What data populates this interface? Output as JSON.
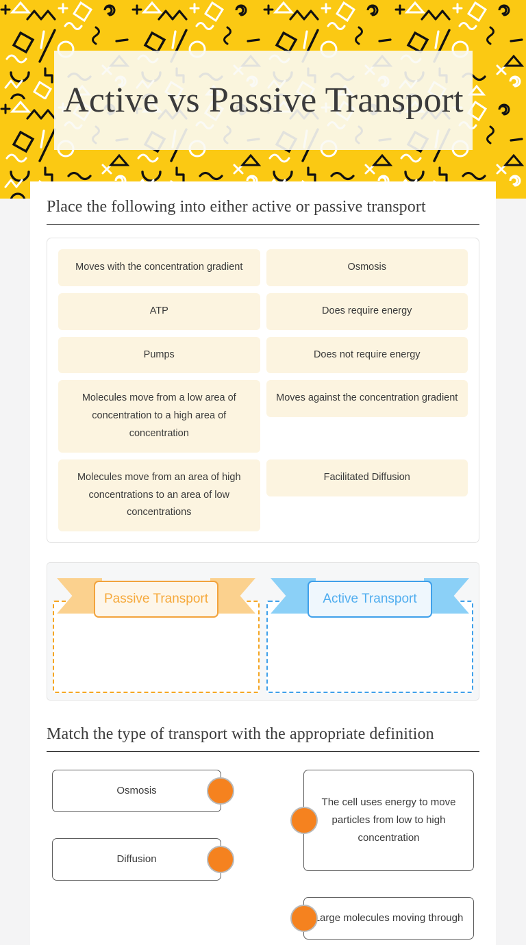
{
  "header": {
    "title": "Active vs Passive Transport",
    "background_color": "#FBC913",
    "title_box_color": "#FAF9F4"
  },
  "sections": {
    "sort": {
      "heading": "Place the following into either active or passive transport",
      "items_left": [
        "Moves with the concentration gradient",
        "ATP",
        "Pumps",
        "Molecules move from a low area of concentration to a high area of concentration",
        "Molecules move from an area of high concentrations to an area of low concentrations"
      ],
      "items_right": [
        "Osmosis",
        "Does require energy",
        "Does not require energy",
        "Moves against the concentration gradient",
        "Facilitated Diffusion"
      ],
      "dropzones": [
        {
          "label": "Passive Transport",
          "accent": "#F5A623",
          "ribbon": "#FBD18E"
        },
        {
          "label": "Active Transport",
          "accent": "#3FA0EA",
          "ribbon": "#8BD0F7"
        }
      ]
    },
    "match": {
      "heading": "Match the type of transport with the appropriate definition",
      "dot_color": "#F5821F",
      "terms": [
        "Osmosis",
        "Diffusion"
      ],
      "definitions": [
        "The cell uses energy to move particles from low to high concentration",
        "Large molecules moving through"
      ]
    }
  }
}
